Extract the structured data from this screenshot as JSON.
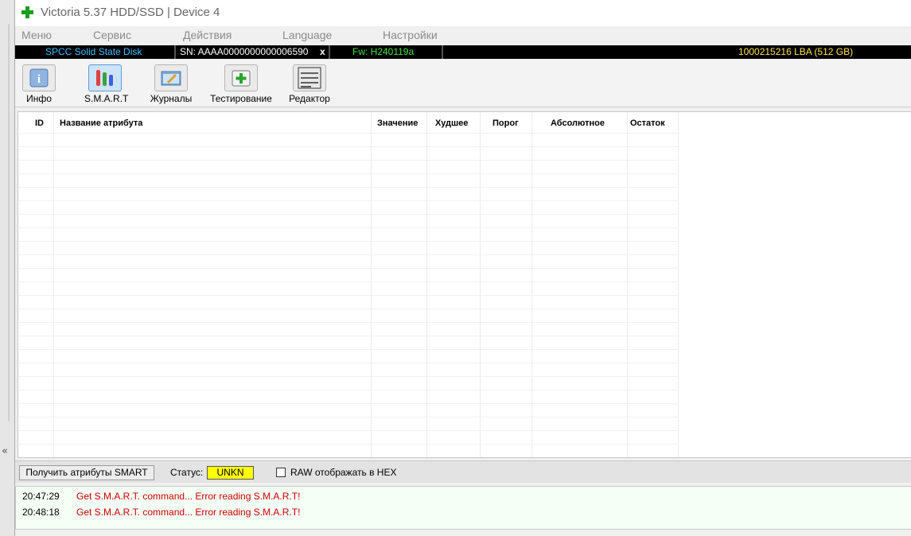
{
  "window": {
    "title": "Victoria 5.37 HDD/SSD | Device 4",
    "collapse_glyph": "«"
  },
  "menu": [
    "Меню",
    "Сервис",
    "Действия",
    "Language",
    "Настройки"
  ],
  "device": {
    "model": "SPCC Solid State Disk",
    "serial": "SN: AAAA0000000000006590",
    "close": "x",
    "firmware": "Fw: H240119a",
    "capacity": "1000215216 LBA (512 GB)"
  },
  "toolbar": [
    {
      "label": "Инфо",
      "icon": "info-icon"
    },
    {
      "label": "S.M.A.R.T",
      "icon": "smart-icon",
      "active": true
    },
    {
      "label": "Журналы",
      "icon": "logs-icon"
    },
    {
      "label": "Тестирование",
      "icon": "test-icon"
    },
    {
      "label": "Редактор",
      "icon": "editor-icon"
    }
  ],
  "table": {
    "columns": [
      "ID",
      "Название атрибута",
      "Значение",
      "Худшее",
      "Порог",
      "Абсолютное",
      "Остаток"
    ],
    "rows": []
  },
  "smart": {
    "get_button": "Получить атрибуты SMART",
    "status_label": "Статус:",
    "status_value": "UNKN",
    "status_color": "#ffff00",
    "hex_label": "RAW отображать в HEX",
    "hex_checked": false
  },
  "log": [
    {
      "time": "20:47:29",
      "message": "Get S.M.A.R.T. command... Error reading S.M.A.R.T!"
    },
    {
      "time": "20:48:18",
      "message": "Get S.M.A.R.T. command... Error reading S.M.A.R.T!"
    }
  ]
}
